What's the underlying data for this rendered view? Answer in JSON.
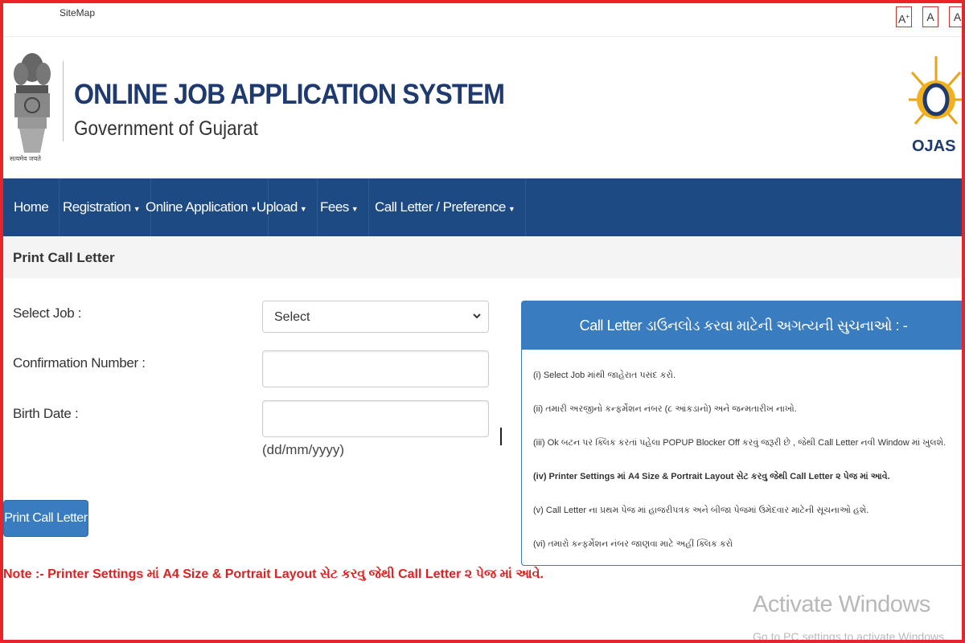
{
  "topbar": {
    "sitemap": "SiteMap",
    "font_large": "A",
    "font_large_sup": "+",
    "font_normal": "A",
    "font_small": "A"
  },
  "header": {
    "title": "ONLINE JOB APPLICATION SYSTEM",
    "subtitle": "Government of Gujarat",
    "emblem_motto": "सत्यमेव जयते",
    "logo_text": "OJAS"
  },
  "nav": {
    "items": [
      {
        "label": "Home",
        "dropdown": false
      },
      {
        "label": "Registration",
        "dropdown": true
      },
      {
        "label": "Online Application",
        "dropdown": true
      },
      {
        "label": "Upload",
        "dropdown": true
      },
      {
        "label": "Fees",
        "dropdown": true
      },
      {
        "label": "Call Letter / Preference",
        "dropdown": true
      }
    ]
  },
  "page": {
    "heading": "Print Call Letter"
  },
  "form": {
    "select_job_label": "Select Job :",
    "select_job_value": "Select",
    "confirmation_label": "Confirmation Number :",
    "confirmation_value": "",
    "birth_date_label": "Birth Date :",
    "birth_date_value": "",
    "birth_date_hint": "(dd/mm/yyyy)",
    "submit_label": "Print Call Letter"
  },
  "note": "Note :- Printer Settings માં A4 Size & Portrait Layout સેટ કરવુ જેથી Call Letter ૨ પેજ માં આવે.",
  "instructions": {
    "heading": "Call Letter ડાઉનલોડ કરવા માટેની અગત્યની સુચનાઓ : -",
    "items": [
      "(i) Select Job માંથી જાહેરાત પસંદ કરો.",
      "(ii) તમારી અરજીનો કન્ફર્મેશન નંબર (૮ આંકડાનો) અને જન્મતારીખ નાખો.",
      "(iii) Ok બટન પર ક્લિક કરતાં પહેલા POPUP Blocker Off કરવું જરૂરી છે , જેથી Call Letter નવી Window માં ખુલશે.",
      "(iv) Printer Settings માં A4 Size & Portrait Layout સેટ કરવુ જેથી Call Letter ૨ પેજ માં આવે.",
      "(v) Call Letter ના પ્રથમ પેજ માં હાજરીપત્રક અને બીજા પેજમાં ઉમેદવાર માટેની સૂચનાઓ હશે.",
      "(vi) તમારો કન્ફર્મેશન નંબર જાણવા માટે અહીં ક્લિક કરો"
    ]
  },
  "watermark": {
    "line1": "Activate Windows",
    "line2": "Go to PC settings to activate Windows."
  },
  "colors": {
    "nav_bg": "#1d4a82",
    "accent": "#3a7cc0",
    "title": "#1f3a6e",
    "note": "#e02020",
    "frame": "#e8232a"
  }
}
